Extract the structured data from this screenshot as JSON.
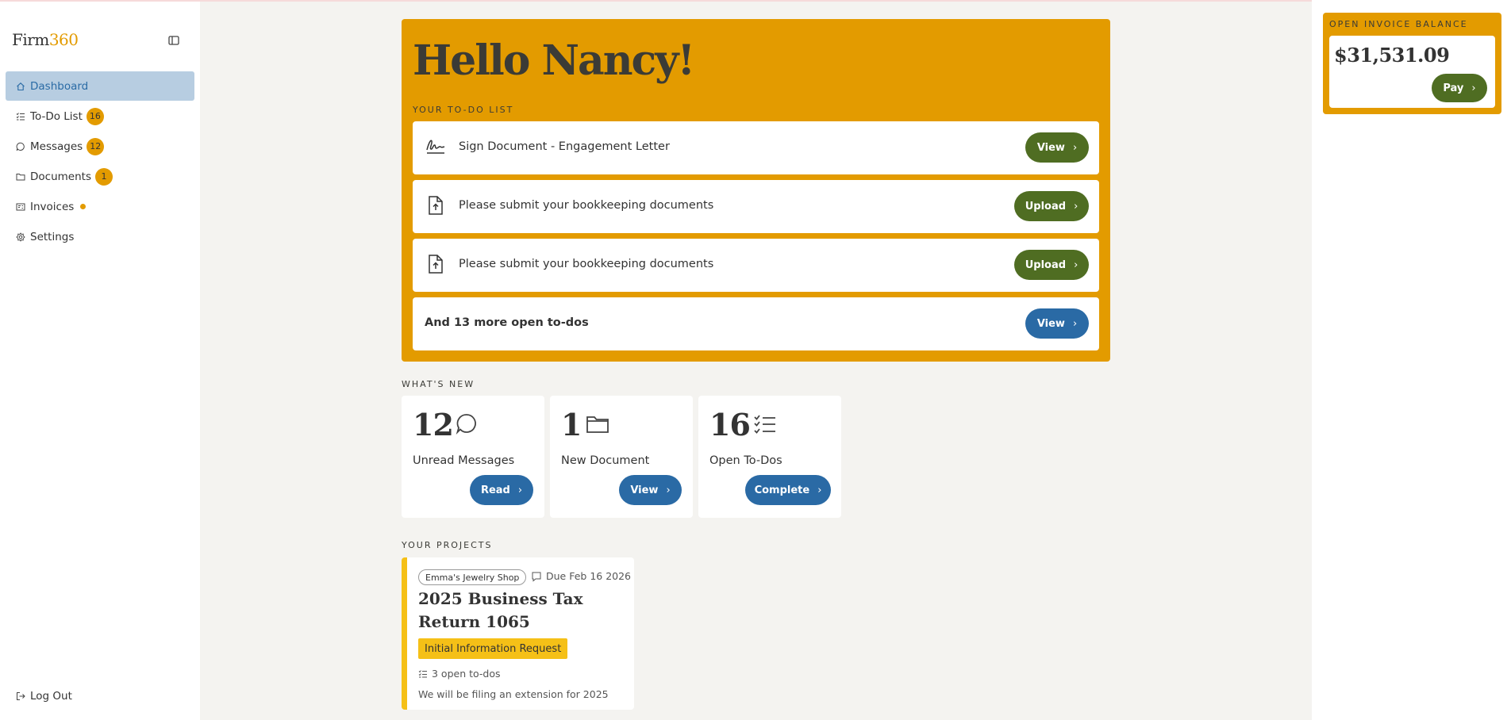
{
  "brand": {
    "name_part1": "Firm",
    "name_part2": "360",
    "accent_color": "#e39b00"
  },
  "sidebar": {
    "items": [
      {
        "label": "Dashboard",
        "icon": "home-icon",
        "active": true
      },
      {
        "label": "To-Do List",
        "icon": "checklist-icon",
        "badge": "16"
      },
      {
        "label": "Messages",
        "icon": "message-icon",
        "badge": "12"
      },
      {
        "label": "Documents",
        "icon": "folder-icon",
        "badge": "1"
      },
      {
        "label": "Invoices",
        "icon": "invoice-icon",
        "dot": true
      },
      {
        "label": "Settings",
        "icon": "gear-icon"
      }
    ],
    "logout_label": "Log Out"
  },
  "greeting": {
    "title": "Hello Nancy!"
  },
  "todo": {
    "section_label": "YOUR TO-DO LIST",
    "items": [
      {
        "text": "Sign Document - Engagement Letter",
        "icon": "signature-icon",
        "button": "View"
      },
      {
        "text": "Please submit your bookkeeping documents",
        "icon": "upload-file-icon",
        "button": "Upload"
      },
      {
        "text": "Please submit your bookkeeping documents",
        "icon": "upload-file-icon",
        "button": "Upload"
      }
    ],
    "more": {
      "text": "And 13 more open to-dos",
      "button": "View"
    }
  },
  "whats_new": {
    "section_label": "WHAT'S NEW",
    "cards": [
      {
        "number": "12",
        "label": "Unread Messages",
        "button": "Read",
        "icon": "message-icon"
      },
      {
        "number": "1",
        "label": "New Document",
        "button": "View",
        "icon": "folder-icon"
      },
      {
        "number": "16",
        "label": "Open To-Dos",
        "button": "Complete",
        "icon": "checklist-icon"
      }
    ]
  },
  "projects": {
    "section_label": "YOUR PROJECTS",
    "items": [
      {
        "client": "Emma's Jewelry Shop",
        "due": "Due Feb 16 2026",
        "title": "2025 Business Tax Return 1065",
        "stage": "Initial Information Request",
        "open_todos": "3 open to-dos",
        "note": "We will be filing an extension for 2025"
      }
    ]
  },
  "invoice": {
    "section_label": "OPEN INVOICE BALANCE",
    "amount": "$31,531.09",
    "button": "Pay"
  },
  "colors": {
    "accent": "#e39b00",
    "green_button": "#4f6d22",
    "blue_button": "#2a6aa5",
    "active_nav": "#b7cde1",
    "project_stripe": "#f5c017"
  }
}
